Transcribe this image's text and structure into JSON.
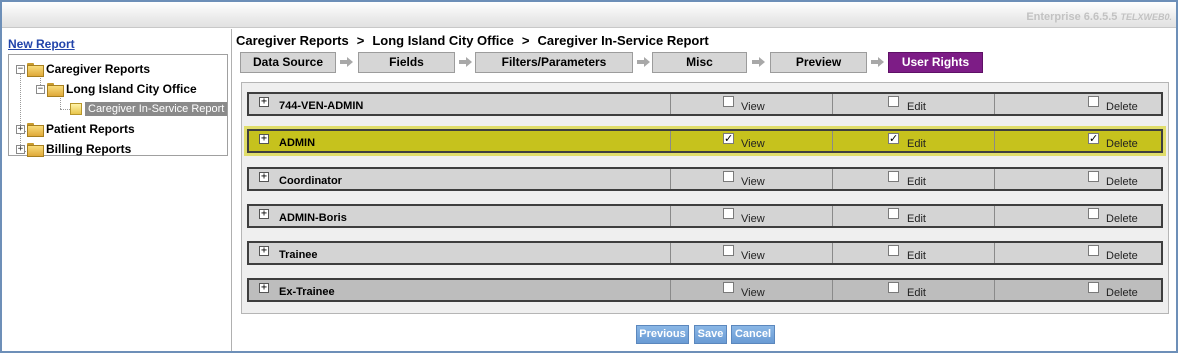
{
  "app": {
    "version": "Enterprise 6.6.5.5",
    "server": "TELXWEB0."
  },
  "sidebar": {
    "new_report_label": "New Report",
    "tree": {
      "root": "Caregiver Reports",
      "office": "Long Island City Office",
      "selected_report": "Caregiver In-Service Report",
      "patient": "Patient Reports",
      "billing": "Billing Reports"
    }
  },
  "breadcrumb": {
    "items": [
      "Caregiver Reports",
      "Long Island City Office",
      "Caregiver In-Service Report"
    ],
    "separator": ">"
  },
  "wizard": {
    "steps": [
      "Data Source",
      "Fields",
      "Filters/Parameters",
      "Misc",
      "Preview",
      "User Rights"
    ],
    "active_step": "User Rights"
  },
  "permission_labels": {
    "view": "View",
    "edit": "Edit",
    "delete": "Delete"
  },
  "roles": [
    {
      "name": "744-VEN-ADMIN",
      "view": false,
      "edit": false,
      "delete": false
    },
    {
      "name": "ADMIN",
      "view": true,
      "edit": true,
      "delete": true,
      "highlighted": true
    },
    {
      "name": "Coordinator",
      "view": false,
      "edit": false,
      "delete": false
    },
    {
      "name": "ADMIN-Boris",
      "view": false,
      "edit": false,
      "delete": false
    },
    {
      "name": "Trainee",
      "view": false,
      "edit": false,
      "delete": false
    },
    {
      "name": "Ex-Trainee",
      "view": false,
      "edit": false,
      "delete": false
    }
  ],
  "actions": {
    "previous": "Previous",
    "save": "Save",
    "cancel": "Cancel"
  },
  "colors": {
    "active_step": "#7d1c86",
    "highlight_row": "#c6c21d",
    "button": "#6a9bd4",
    "link": "#2244aa"
  }
}
